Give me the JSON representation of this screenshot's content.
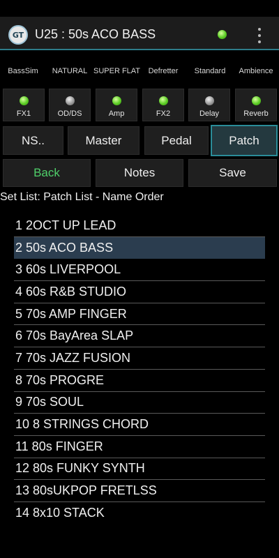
{
  "header": {
    "title": "U25 : 50s ACO BASS",
    "logo_icon": "boss-tone-studio-logo-icon",
    "status_color": "#5ccd25"
  },
  "fx_labels": [
    "BassSim",
    "NATURAL",
    "SUPER FLAT",
    "Defretter",
    "Standard",
    "Ambience"
  ],
  "fx_buttons": [
    {
      "label": "FX1",
      "on": true
    },
    {
      "label": "OD/DS",
      "on": false
    },
    {
      "label": "Amp",
      "on": true
    },
    {
      "label": "FX2",
      "on": true
    },
    {
      "label": "Delay",
      "on": false
    },
    {
      "label": "Reverb",
      "on": true
    }
  ],
  "nav_buttons": {
    "ns": "NS..",
    "master": "Master",
    "pedal": "Pedal",
    "patch": "Patch",
    "active": "Patch"
  },
  "actions": {
    "back": "Back",
    "notes": "Notes",
    "save": "Save"
  },
  "set_list": "Set List: Patch List - Name Order",
  "patches": [
    "1 2OCT UP LEAD",
    "2 50s ACO BASS",
    "3 60s LIVERPOOL",
    "4 60s R&B STUDIO",
    "5 70s AMP FINGER",
    "6 70s BayArea SLAP",
    "7 70s JAZZ FUSION",
    "8 70s PROGRE",
    "9 70s SOUL",
    "10 8 STRINGS CHORD",
    "11 80s FINGER",
    "12 80s FUNKY SYNTH",
    "13 80sUKPOP FRETLSS",
    "14 8x10 STACK"
  ],
  "selected_patch": "2 50s ACO BASS",
  "colors": {
    "accent": "#2a8d99",
    "back_text": "#4fd06a",
    "selected_row": "#2b3d4f"
  }
}
